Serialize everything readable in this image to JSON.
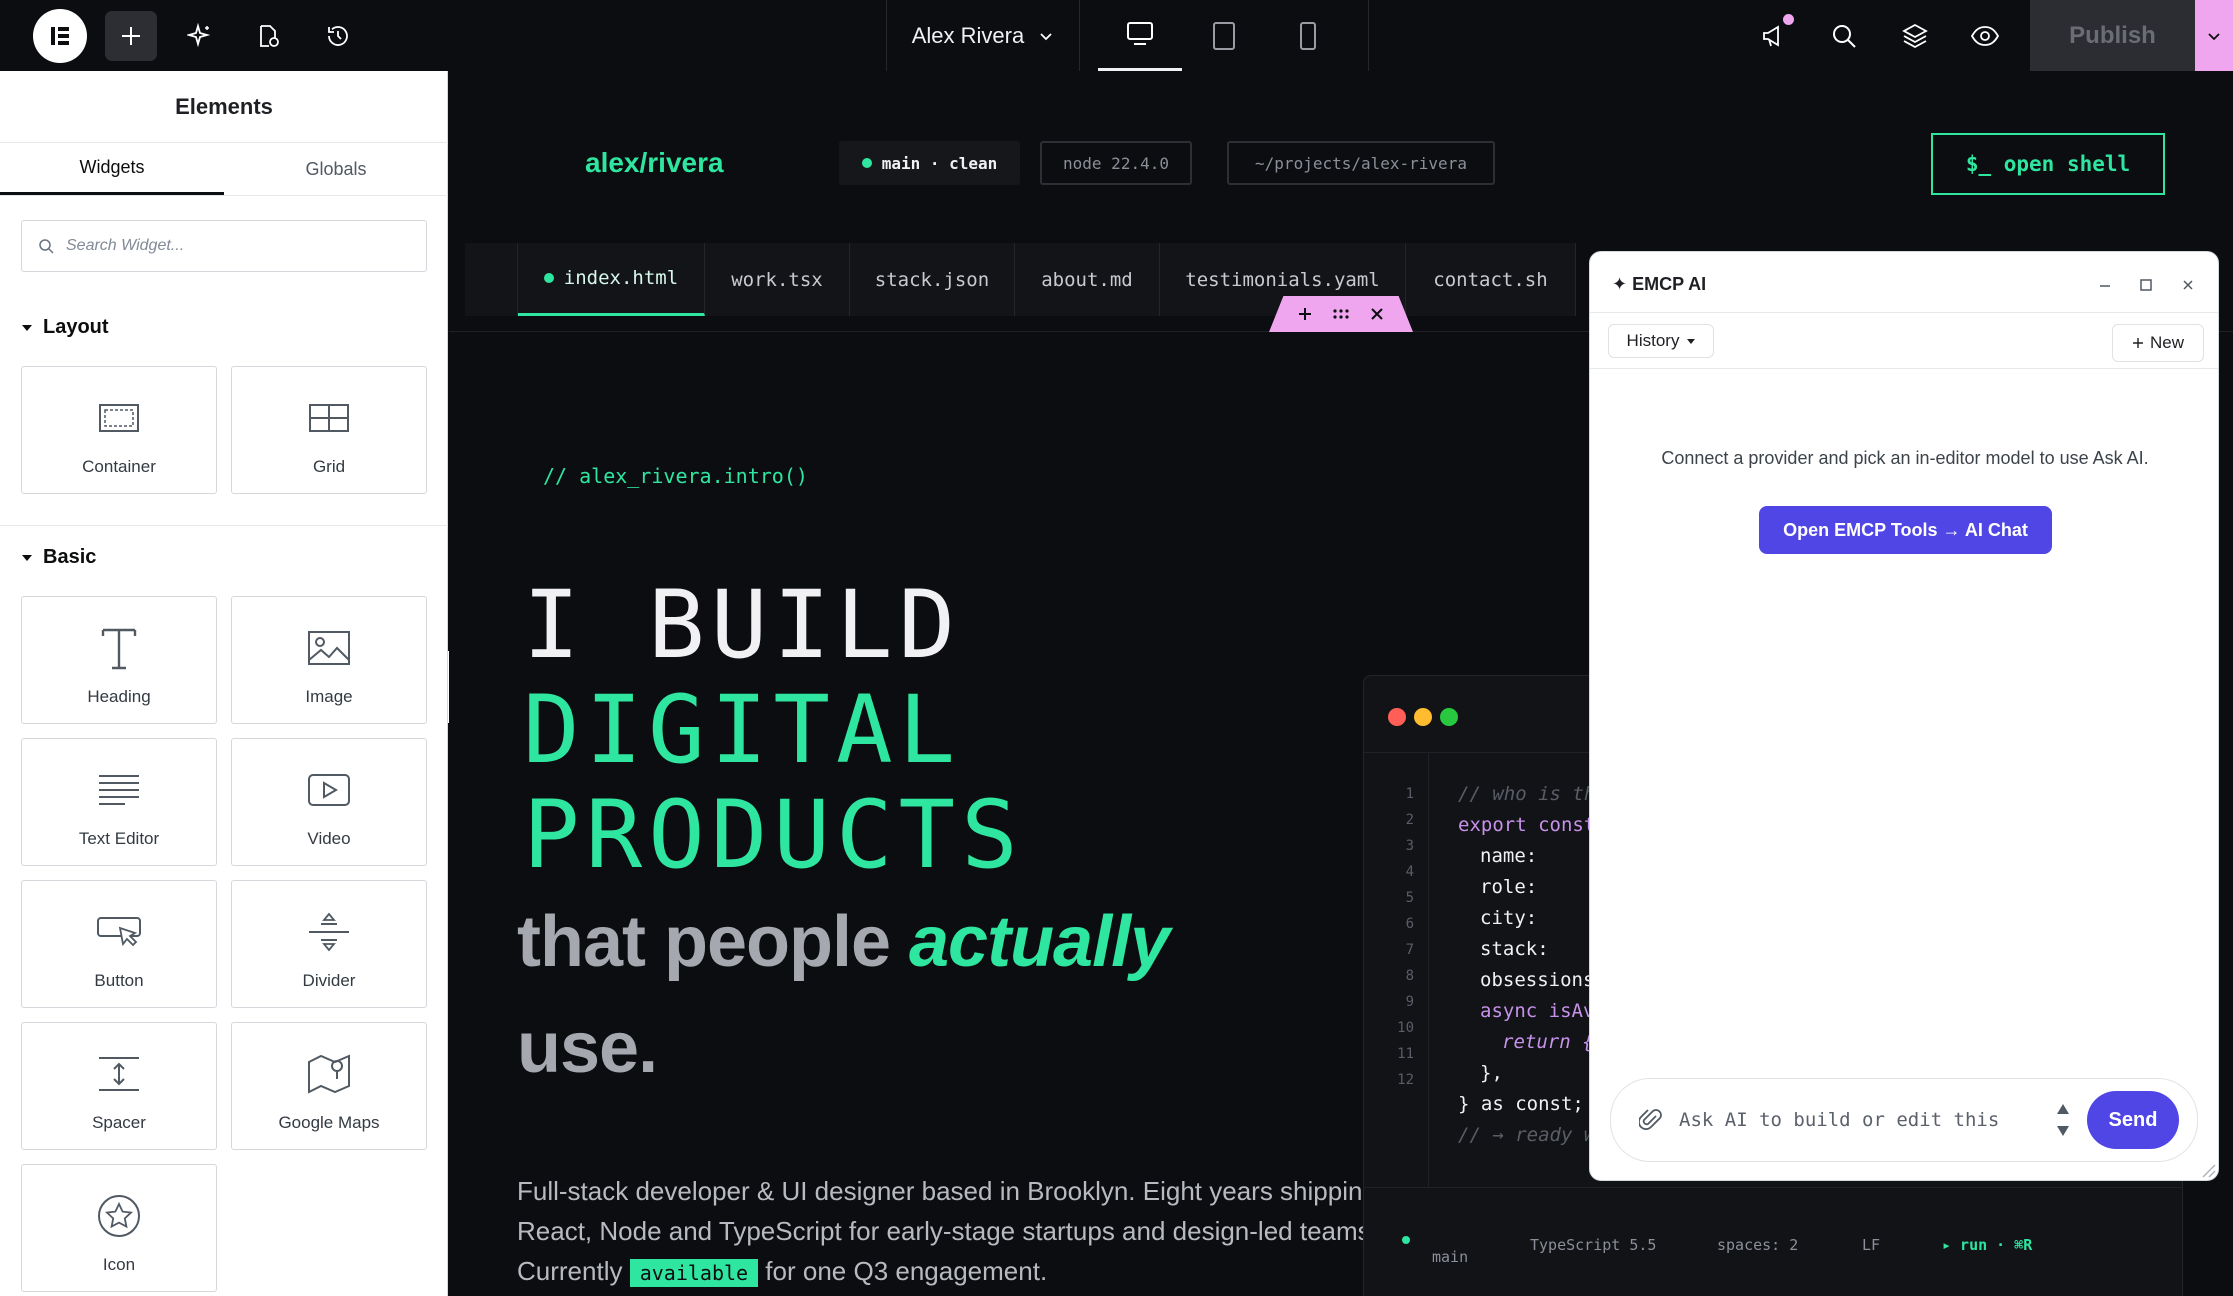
{
  "topbar": {
    "user_name": "Alex Rivera",
    "publish_label": "Publish",
    "icons": [
      "elementor-logo-icon",
      "plus-icon",
      "ai-sparkle-icon",
      "page-settings-icon",
      "history-icon",
      "chevron-down-icon",
      "desktop-icon",
      "tablet-icon",
      "mobile-icon",
      "megaphone-icon",
      "search-icon",
      "layers-icon",
      "eye-icon"
    ]
  },
  "panel": {
    "title": "Elements",
    "tabs": [
      {
        "label": "Widgets"
      },
      {
        "label": "Globals"
      }
    ],
    "search_placeholder": "Search Widget...",
    "sections": [
      {
        "label": "Layout"
      },
      {
        "label": "Basic"
      }
    ],
    "layout_widgets": [
      {
        "label": "Container"
      },
      {
        "label": "Grid"
      }
    ],
    "basic_widgets": [
      {
        "label": "Heading"
      },
      {
        "label": "Image"
      },
      {
        "label": "Text Editor"
      },
      {
        "label": "Video"
      },
      {
        "label": "Button"
      },
      {
        "label": "Divider"
      },
      {
        "label": "Spacer"
      },
      {
        "label": "Google Maps"
      },
      {
        "label": "Icon"
      }
    ]
  },
  "site": {
    "brand": "alex/rivera",
    "branch": "main · clean",
    "node": "node 22.4.0",
    "path": "~/projects/alex-rivera",
    "shell_label": "$_ open shell",
    "file_tabs": [
      {
        "label": "index.html"
      },
      {
        "label": "work.tsx"
      },
      {
        "label": "stack.json"
      },
      {
        "label": "about.md"
      },
      {
        "label": "testimonials.yaml"
      },
      {
        "label": "contact.sh"
      }
    ],
    "intro": "// alex_rivera.intro()",
    "hero": {
      "line1": "I BUILD",
      "line2": "DIGITAL",
      "line3": "PRODUCTS"
    },
    "subhero": {
      "part1": "that people ",
      "emph": "actually",
      "part2": "use."
    },
    "bio": {
      "before": "Full-stack developer & UI designer based in Brooklyn. Eight years shipping React, Node and TypeScript for early-stage startups and design-led teams. Currently ",
      "badge": "available",
      "after": " for one Q3 engagement."
    },
    "code": {
      "line_numbers": [
        "1",
        "2",
        "3",
        "4",
        "5",
        "6",
        "7",
        "8",
        "9",
        "10",
        "11",
        "12"
      ],
      "lines": [
        "// who is th",
        "export const",
        "name:",
        "role:",
        "city:",
        "stack:",
        "obsessions",
        "async isAv",
        "return {",
        "},",
        "} as const;",
        "// → ready w"
      ],
      "status": {
        "branch": "main",
        "lang": "TypeScript 5.5",
        "spaces": "spaces: 2",
        "eol": "LF",
        "run": "▸ run · ⌘R"
      }
    }
  },
  "ai": {
    "title": "✦ EMCP AI",
    "history_label": "History",
    "new_label": "New",
    "message": "Connect a provider and pick an in-editor model to use Ask AI.",
    "cta_label": "Open EMCP Tools → AI Chat",
    "input_placeholder": "Ask AI to build or edit this",
    "send_label": "Send"
  }
}
